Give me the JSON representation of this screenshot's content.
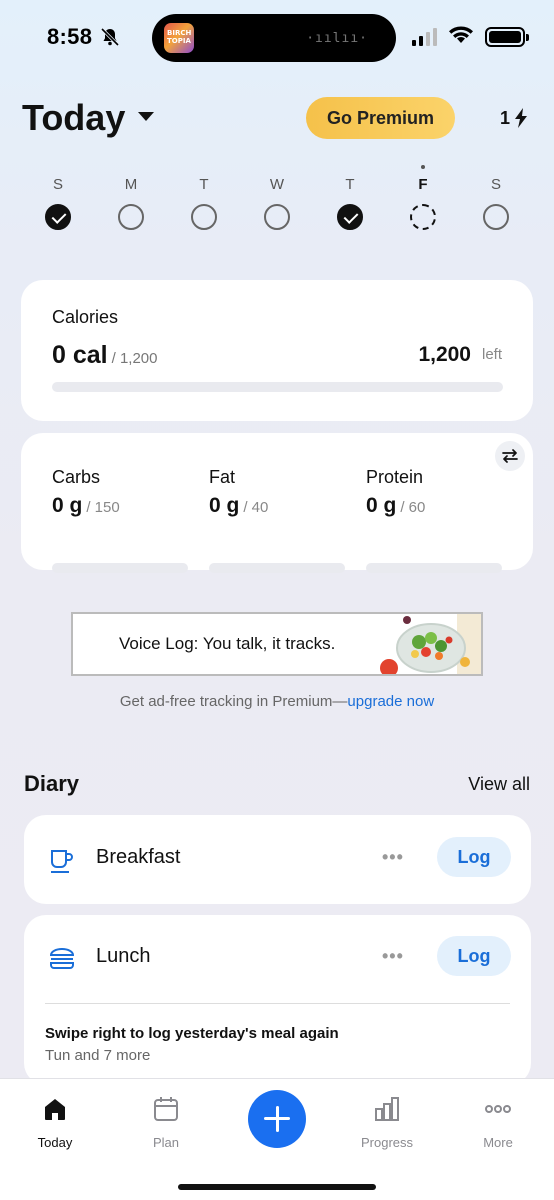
{
  "status_bar": {
    "time": "8:58"
  },
  "header": {
    "title": "Today",
    "premium_label": "Go Premium",
    "streak": "1"
  },
  "week": [
    {
      "letter": "S",
      "state": "done"
    },
    {
      "letter": "M",
      "state": "empty"
    },
    {
      "letter": "T",
      "state": "empty"
    },
    {
      "letter": "W",
      "state": "empty"
    },
    {
      "letter": "T",
      "state": "done"
    },
    {
      "letter": "F",
      "state": "today"
    },
    {
      "letter": "S",
      "state": "empty"
    }
  ],
  "calories": {
    "label": "Calories",
    "value": "0 cal",
    "goal": "/ 1,200",
    "left_value": "1,200",
    "left_label": "left",
    "progress": 0
  },
  "macros": [
    {
      "name": "Carbs",
      "value": "0 g",
      "goal": "/ 150",
      "progress": 0
    },
    {
      "name": "Fat",
      "value": "0 g",
      "goal": "/ 40",
      "progress": 0
    },
    {
      "name": "Protein",
      "value": "0 g",
      "goal": "/ 60",
      "progress": 0
    }
  ],
  "ad": {
    "text": "Voice Log: You talk, it tracks.",
    "note": "Get ad-free tracking in Premium—",
    "note_link": "upgrade now"
  },
  "diary": {
    "title": "Diary",
    "view_all": "View all",
    "meals": [
      {
        "name": "Breakfast",
        "more": "•••",
        "log_label": "Log"
      },
      {
        "name": "Lunch",
        "more": "•••",
        "log_label": "Log"
      }
    ],
    "hint_title": "Swipe right to log yesterday's meal again",
    "hint_sub": "Tun and 7 more"
  },
  "tabs": [
    {
      "label": "Today",
      "icon": "home-icon",
      "active": true
    },
    {
      "label": "Plan",
      "icon": "calendar-icon",
      "active": false
    },
    {
      "label": "Progress",
      "icon": "bar-chart-icon",
      "active": false
    },
    {
      "label": "More",
      "icon": "more-icon",
      "active": false
    }
  ],
  "colors": {
    "accent": "#1a6ff0",
    "premium": "#f5c14a",
    "log_bg": "#e3f0fc",
    "log_text": "#1a6ed8"
  }
}
